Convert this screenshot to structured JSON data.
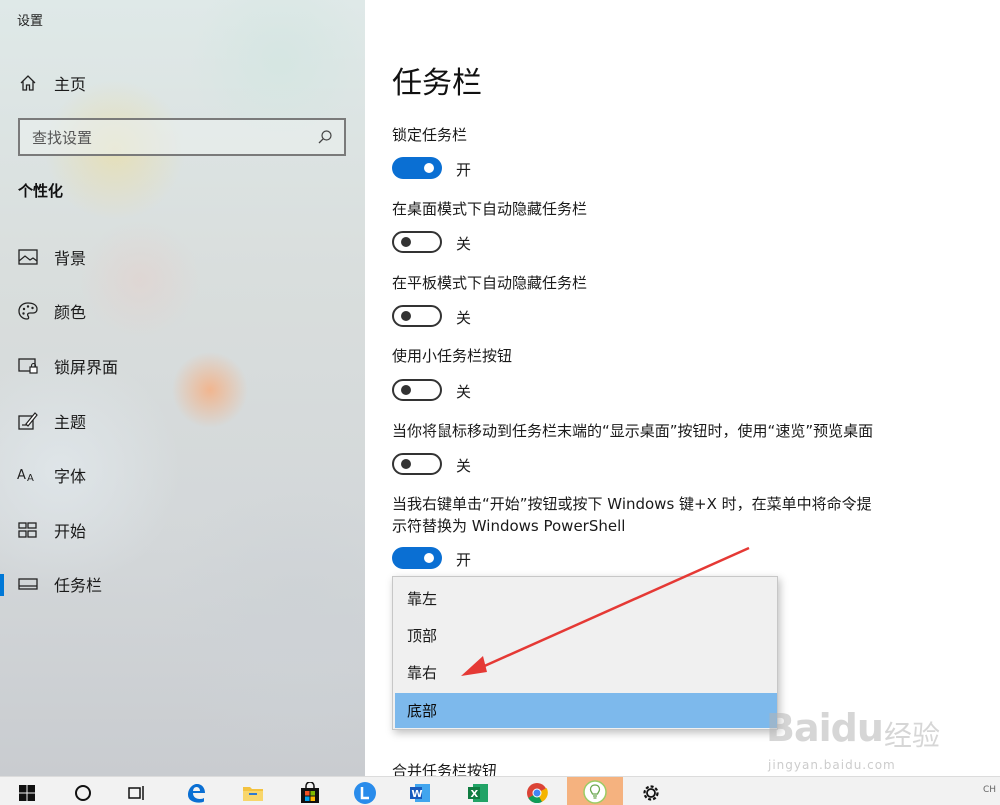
{
  "window": {
    "title": "设置"
  },
  "sidebar": {
    "home_label": "主页",
    "search_placeholder": "查找设置",
    "section": "个性化",
    "items": [
      {
        "label": "背景",
        "icon": "picture-icon"
      },
      {
        "label": "颜色",
        "icon": "palette-icon"
      },
      {
        "label": "锁屏界面",
        "icon": "lock-screen-icon"
      },
      {
        "label": "主题",
        "icon": "theme-brush-icon"
      },
      {
        "label": "字体",
        "icon": "font-icon"
      },
      {
        "label": "开始",
        "icon": "start-grid-icon"
      },
      {
        "label": "任务栏",
        "icon": "taskbar-icon",
        "active": true
      }
    ]
  },
  "main": {
    "title": "任务栏",
    "settings": [
      {
        "label": "锁定任务栏",
        "state": "开",
        "on": true
      },
      {
        "label": "在桌面模式下自动隐藏任务栏",
        "state": "关",
        "on": false
      },
      {
        "label": "在平板模式下自动隐藏任务栏",
        "state": "关",
        "on": false
      },
      {
        "label": "使用小任务栏按钮",
        "state": "关",
        "on": false
      },
      {
        "label": "当你将鼠标移动到任务栏末端的“显示桌面”按钮时，使用“速览”预览桌面",
        "state": "关",
        "on": false
      },
      {
        "label_line1": "当我右键单击“开始”按钮或按下 Windows 键+X 时，在菜单中将命令提",
        "label_line2": "示符替换为 Windows PowerShell",
        "state": "开",
        "on": true
      }
    ],
    "next_label": "合并任务栏按钮"
  },
  "dropdown": {
    "options": [
      "靠左",
      "顶部",
      "靠右",
      "底部"
    ],
    "selected": "底部"
  },
  "watermark": {
    "logo": "Baidu",
    "cn": "经验",
    "sub": "jingyan.baidu.com"
  },
  "taskbar": {
    "tray_text": "CH"
  },
  "colors": {
    "accent": "#0078d7",
    "toggle_on": "#0a6fd3",
    "selected_option": "#7db9ec",
    "arrow": "#e53935"
  }
}
